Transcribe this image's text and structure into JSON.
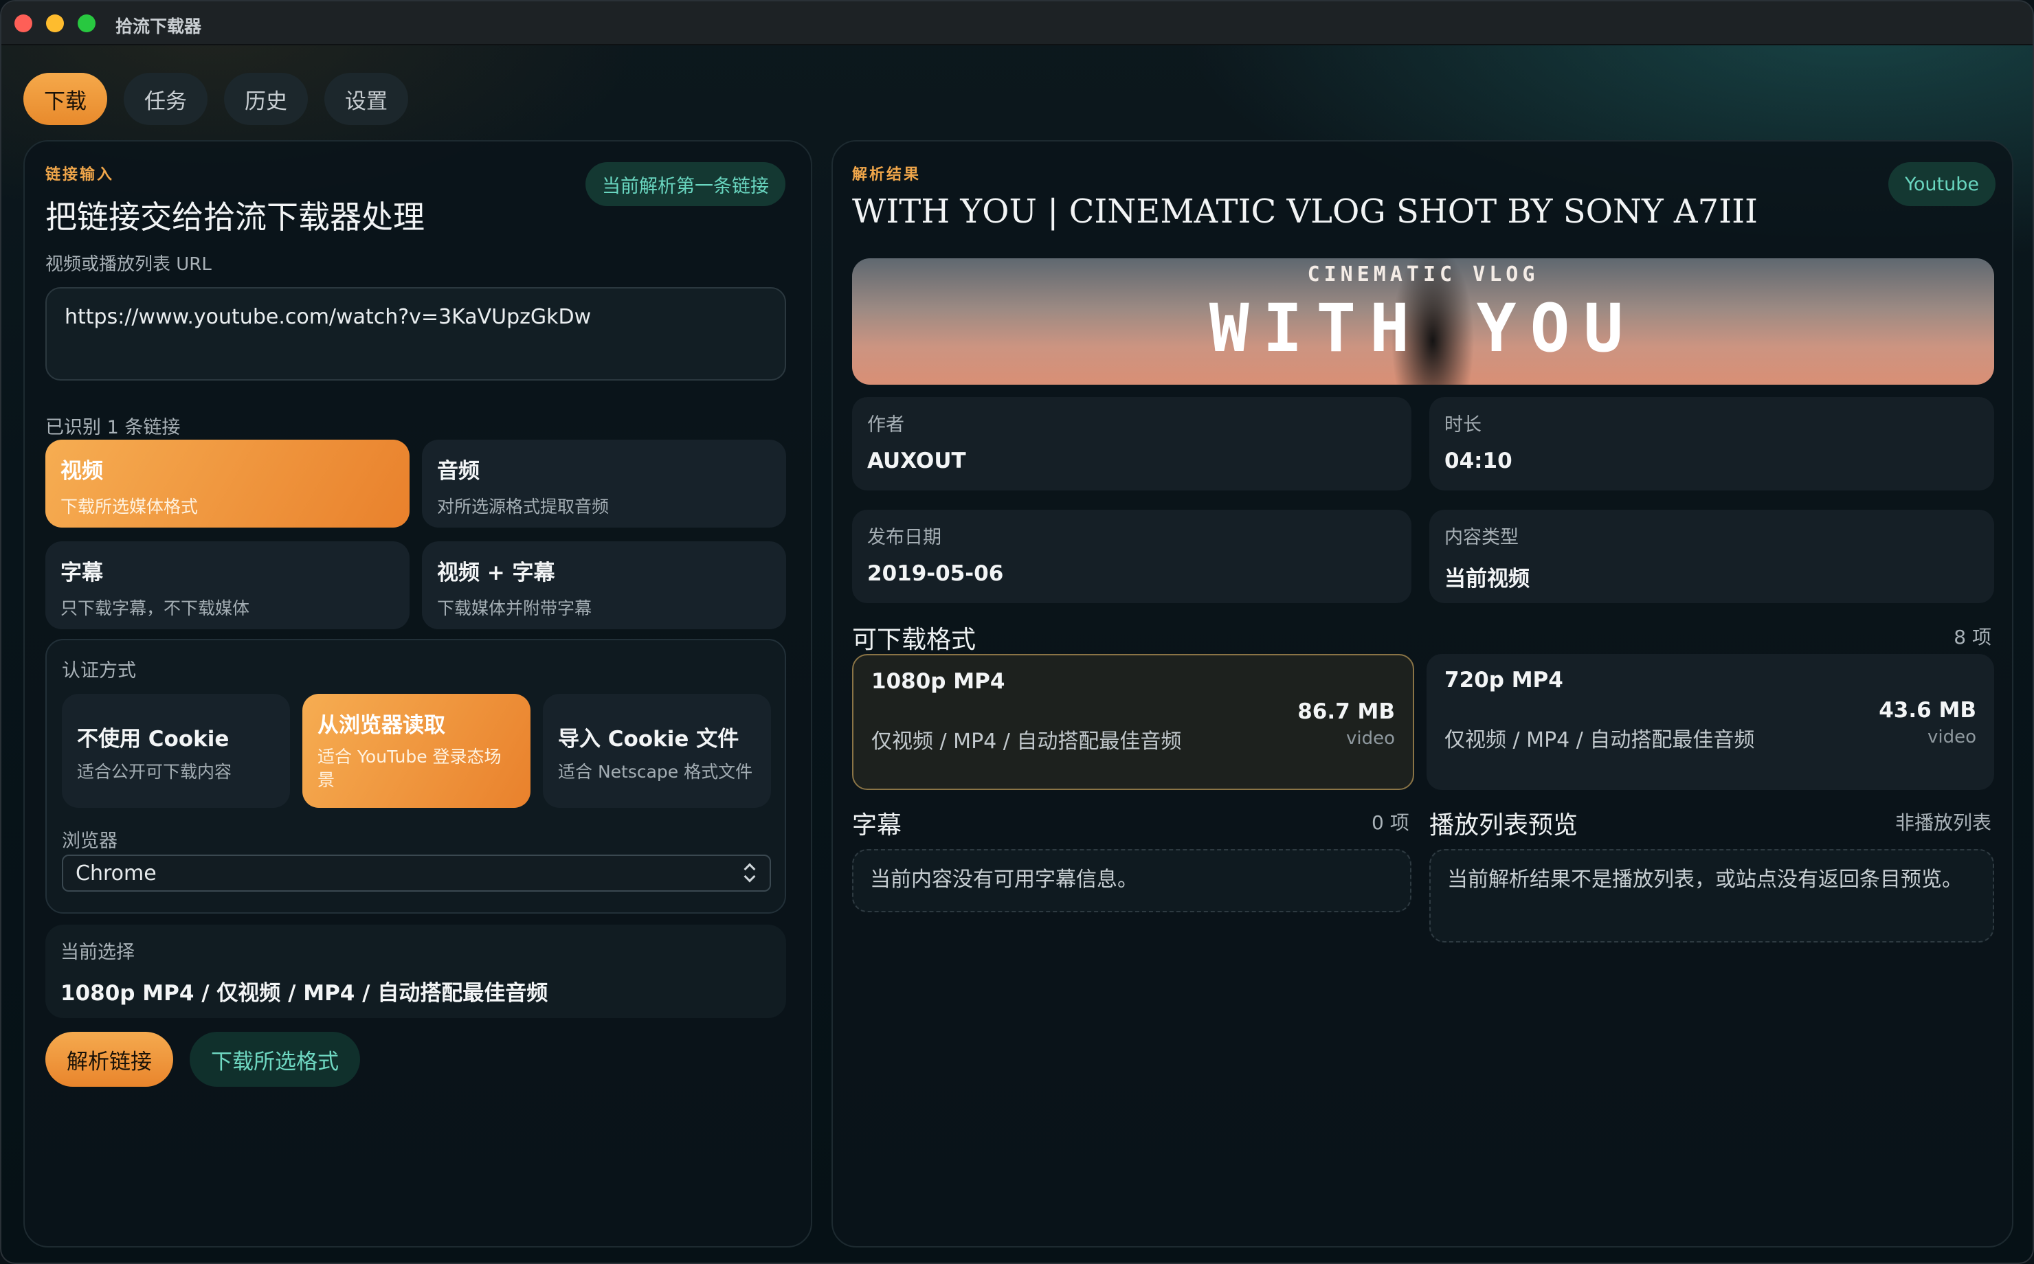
{
  "window": {
    "title": "拾流下载器"
  },
  "tabs": [
    {
      "label": "下载",
      "active": true
    },
    {
      "label": "任务",
      "active": false
    },
    {
      "label": "历史",
      "active": false
    },
    {
      "label": "设置",
      "active": false
    }
  ],
  "left": {
    "eyebrow": "链接输入",
    "heading": "把链接交给拾流下载器处理",
    "parse_hint": "当前解析第一条链接",
    "url_label": "视频或播放列表 URL",
    "url_value": "https://www.youtube.com/watch?v=3KaVUpzGkDw",
    "recognized": "已识别 1 条链接",
    "modes": [
      {
        "title": "视频",
        "sub": "下载所选媒体格式",
        "active": true
      },
      {
        "title": "音频",
        "sub": "对所选源格式提取音频",
        "active": false
      },
      {
        "title": "字幕",
        "sub": "只下载字幕，不下载媒体",
        "active": false
      },
      {
        "title": "视频 + 字幕",
        "sub": "下载媒体并附带字幕",
        "active": false
      }
    ],
    "auth": {
      "label": "认证方式",
      "options": [
        {
          "title": "不使用 Cookie",
          "sub": "适合公开可下载内容",
          "active": false
        },
        {
          "title": "从浏览器读取",
          "sub": "适合 YouTube 登录态场景",
          "active": true
        },
        {
          "title": "导入 Cookie 文件",
          "sub": "适合 Netscape 格式文件",
          "active": false
        }
      ],
      "browser_label": "浏览器",
      "browser_value": "Chrome"
    },
    "selection": {
      "label": "当前选择",
      "value": "1080p MP4 / 仅视频 / MP4 / 自动搭配最佳音频"
    },
    "buttons": {
      "parse": "解析链接",
      "download": "下载所选格式"
    }
  },
  "right": {
    "eyebrow": "解析结果",
    "title": "WITH YOU | CINEMATIC VLOG SHOT BY SONY A7III",
    "platform": "Youtube",
    "banner": {
      "small": "CINEMATIC VLOG",
      "big": "WITH YOU"
    },
    "meta": [
      {
        "key": "作者",
        "value": "AUXOUT"
      },
      {
        "key": "时长",
        "value": "04:10"
      },
      {
        "key": "发布日期",
        "value": "2019-05-06"
      },
      {
        "key": "内容类型",
        "value": "当前视频"
      }
    ],
    "formats_title": "可下载格式",
    "formats_count": "8 项",
    "formats": [
      {
        "title": "1080p MP4",
        "desc": "仅视频 / MP4 / 自动搭配最佳音频",
        "size": "86.7 MB",
        "type": "video",
        "active": true
      },
      {
        "title": "720p MP4",
        "desc": "仅视频 / MP4 / 自动搭配最佳音频",
        "size": "43.6 MB",
        "type": "video",
        "active": false
      }
    ],
    "subtitles": {
      "title": "字幕",
      "count": "0 项",
      "empty": "当前内容没有可用字幕信息。"
    },
    "playlist": {
      "title": "播放列表预览",
      "count": "非播放列表",
      "empty": "当前解析结果不是播放列表，或站点没有返回条目预览。"
    }
  }
}
